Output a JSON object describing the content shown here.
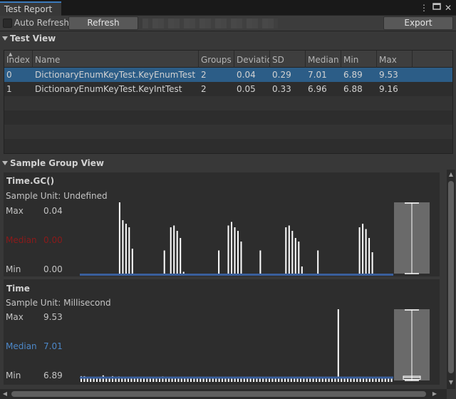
{
  "window": {
    "tab_title": "Test Report"
  },
  "toolbar": {
    "auto_refresh_label": "Auto Refresh",
    "refresh_label": "Refresh",
    "export_label": "Export"
  },
  "test_view": {
    "title": "Test View",
    "columns": [
      "Index",
      "Name",
      "Groups",
      "Deviatio",
      "SD",
      "Median",
      "Min",
      "Max"
    ],
    "rows": [
      [
        "0",
        "DictionaryEnumKeyTest.KeyEnumTest",
        "2",
        "0.04",
        "0.29",
        "7.01",
        "6.89",
        "9.53"
      ],
      [
        "1",
        "DictionaryEnumKeyTest.KeyIntTest",
        "2",
        "0.05",
        "0.33",
        "6.96",
        "6.88",
        "9.16"
      ]
    ]
  },
  "sample_group_view": {
    "title": "Sample Group View",
    "groups": [
      {
        "name": "Time.GC()",
        "unit_label": "Sample Unit: Undefined",
        "max_label": "Max",
        "max_value": "0.04",
        "median_label": "Median",
        "median_value": "0.00",
        "min_label": "Min",
        "min_value": "0.00",
        "median_color": "#8b1a1a",
        "bar_count": 96,
        "samples": [
          0,
          0,
          0,
          0,
          0,
          0,
          0,
          0,
          0,
          0,
          0,
          0,
          0.04,
          0.03,
          0.028,
          0.026,
          0.014,
          0,
          0,
          0,
          0,
          0,
          0,
          0,
          0,
          0,
          0.013,
          0,
          0.026,
          0.027,
          0.024,
          0.02,
          0.001,
          0,
          0,
          0,
          0,
          0,
          0,
          0,
          0,
          0,
          0,
          0.013,
          0,
          0,
          0.027,
          0.029,
          0.026,
          0.024,
          0.018,
          0,
          0,
          0,
          0,
          0,
          0.013,
          0,
          0,
          0,
          0,
          0,
          0,
          0,
          0.026,
          0.027,
          0.024,
          0.02,
          0.018,
          0.004,
          0,
          0,
          0,
          0,
          0.013,
          0,
          0,
          0,
          0,
          0,
          0,
          0,
          0,
          0,
          0,
          0,
          0,
          0.026,
          0.028,
          0.025,
          0.02,
          0.012,
          0,
          0,
          0,
          0,
          0,
          0
        ],
        "box": {
          "min": 0.0,
          "q1": 0.0,
          "median": 0.0,
          "q3": 0.0,
          "max": 0.04
        }
      },
      {
        "name": "Time",
        "unit_label": "Sample Unit: Millisecond",
        "max_label": "Max",
        "max_value": "9.53",
        "median_label": "Median",
        "median_value": "7.01",
        "min_label": "Min",
        "min_value": "6.89",
        "median_color": "#4d88c9",
        "bar_count": 100,
        "samples": [
          7.05,
          7.05,
          7.02,
          7.03,
          7.01,
          7.01,
          7.01,
          7.08,
          7.01,
          7.0,
          7.05,
          7.01,
          7.04,
          7.03,
          7.02,
          7.01,
          7.02,
          7.02,
          7.01,
          7.03,
          7.01,
          7.02,
          7.01,
          7.0,
          7.02,
          7.01,
          7.04,
          7.01,
          7.0,
          7.01,
          7.02,
          7.01,
          7.02,
          7.02,
          7.01,
          7.03,
          7.03,
          7.01,
          7.02,
          7.01,
          7.01,
          7.01,
          7.02,
          7.01,
          7.02,
          7.01,
          7.01,
          7.02,
          7.01,
          7.01,
          7.03,
          7.01,
          7.01,
          7.02,
          7.0,
          7.01,
          7.02,
          7.01,
          7.01,
          7.03,
          7.02,
          7.01,
          7.01,
          7.02,
          7.01,
          7.01,
          7.01,
          7.02,
          7.01,
          7.01,
          7.0,
          7.01,
          7.01,
          7.02,
          7.01,
          7.01,
          7.02,
          7.01,
          7.01,
          7.01,
          7.02,
          7.01,
          7.01,
          7.01,
          7.02,
          7.01,
          7.01,
          7.01,
          7.01,
          7.02,
          7.01,
          7.01,
          7.01,
          7.01,
          7.01,
          7.01,
          7.01,
          7.02,
          7.01,
          7.01
        ],
        "peak_index": 82,
        "peak_value": 9.53,
        "box": {
          "min": 6.89,
          "q1": 6.93,
          "median": 7.01,
          "q3": 7.05,
          "max": 9.53
        }
      }
    ]
  },
  "colors": {
    "accent_blue": "#3a79bb",
    "selection": "#2c5d87",
    "median_line": "#3a5f9c"
  }
}
